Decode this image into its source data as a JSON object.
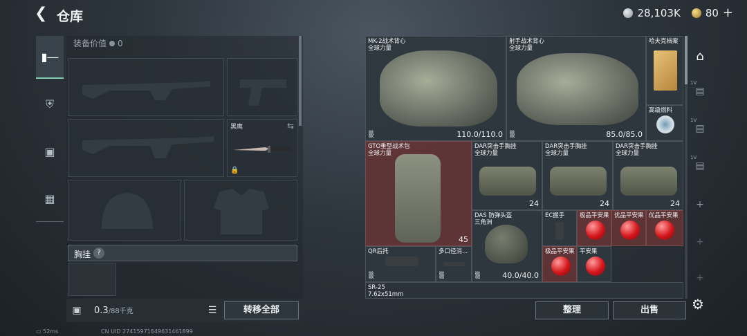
{
  "header": {
    "title": "仓库",
    "silver": "28,103K",
    "gold": "80"
  },
  "rail": {
    "icons": [
      "pistol-icon",
      "armor-icon",
      "backpack-icon",
      "toolbox-icon"
    ]
  },
  "loadout": {
    "equip_value_label": "装备价值",
    "equip_value": "0",
    "melee": {
      "label": "黑鹰"
    },
    "chest_rig_label": "胸挂",
    "help": "?",
    "weight": "0.3",
    "weight_capacity": "/88千克",
    "transfer_all": "转移全部"
  },
  "inventory": {
    "items": [
      {
        "name": "MK-2战术背心",
        "sub": "全球力量",
        "qty": "110.0/110.0"
      },
      {
        "name": "射手战术背心",
        "sub": "全球力量",
        "qty": "85.0/85.0"
      },
      {
        "name": "哈夫克档案",
        "sub": "",
        "qty": ""
      },
      {
        "name": "高级燃料",
        "sub": "",
        "qty": ""
      },
      {
        "name": "GTO重型战术包",
        "sub": "全球力量",
        "qty": "45"
      },
      {
        "name": "DAR突击手胸挂",
        "sub": "全球力量",
        "qty": "24"
      },
      {
        "name": "DAR突击手胸挂",
        "sub": "全球力量",
        "qty": "24"
      },
      {
        "name": "DAR突击手胸挂",
        "sub": "全球力量",
        "qty": "24"
      },
      {
        "name": "DAS 防弹头盔",
        "sub": "三角洲",
        "qty": "40.0/40.0"
      },
      {
        "name": "EC握手",
        "sub": "",
        "qty": ""
      },
      {
        "name": "极品平安果",
        "sub": "",
        "qty": ""
      },
      {
        "name": "优品平安果",
        "sub": "",
        "qty": ""
      },
      {
        "name": "优品平安果",
        "sub": "",
        "qty": ""
      },
      {
        "name": "QR后托",
        "sub": "",
        "qty": ""
      },
      {
        "name": "多口径消...",
        "sub": "",
        "qty": ""
      },
      {
        "name": "极品平安果",
        "sub": "",
        "qty": ""
      },
      {
        "name": "平安果",
        "sub": "",
        "qty": ""
      },
      {
        "name": "SR-25",
        "sub": "7.62x51mm",
        "qty": ""
      }
    ]
  },
  "actions": {
    "organize": "整理",
    "sell": "出售"
  },
  "status": {
    "ping": "52ms",
    "uid": "CN UID 27415971649631461899"
  }
}
